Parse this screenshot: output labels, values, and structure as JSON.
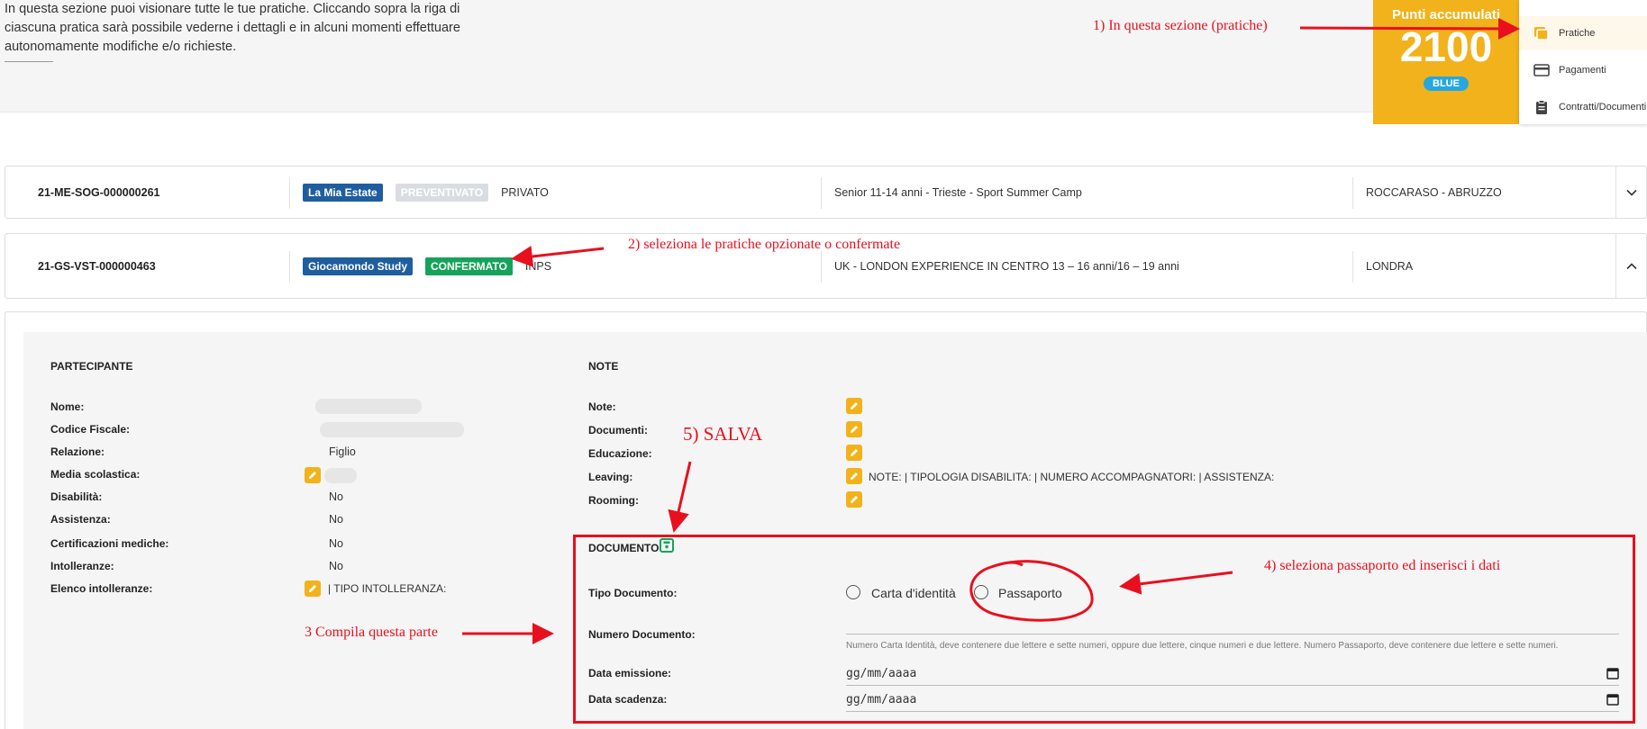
{
  "intro": {
    "line1": "In questa sezione puoi visionare tutte le tue pratiche. Cliccando sopra la riga di",
    "line2": "ciascuna pratica sarà possibile vederne i dettagli e in alcuni momenti effettuare",
    "line3": "autonomamente modifiche e/o richieste."
  },
  "points": {
    "title": "Punti accumulati",
    "value": "2100",
    "level": "BLUE"
  },
  "side_menu": {
    "items": [
      {
        "label": "Pratiche",
        "icon": "folder-icon",
        "active": true
      },
      {
        "label": "Pagamenti",
        "icon": "credit-card-icon",
        "active": false
      },
      {
        "label": "Contratti/Documenti",
        "icon": "clipboard-icon",
        "active": false
      }
    ]
  },
  "practices": [
    {
      "code": "21-ME-SOG-000000261",
      "brand": "La Mia Estate",
      "status": "PREVENTIVATO",
      "type": "PRIVATO",
      "description": "Senior 11-14 anni - Trieste - Sport Summer Camp",
      "location": "ROCCARASO - ABRUZZO"
    },
    {
      "code": "21-GS-VST-000000463",
      "brand": "Giocamondo Study",
      "status": "CONFERMATO",
      "type": "INPS",
      "description": "UK - LONDON EXPERIENCE IN CENTRO 13 – 16 anni/16 – 19 anni",
      "location": "LONDRA"
    }
  ],
  "participant": {
    "heading": "PARTECIPANTE",
    "fields": {
      "nome": "Nome:",
      "codice_fiscale": "Codice Fiscale:",
      "relazione": "Relazione:",
      "relazione_val": "Figlio",
      "media": "Media scolastica:",
      "disabilita": "Disabilità:",
      "disabilita_val": "No",
      "assistenza": "Assistenza:",
      "assistenza_val": "No",
      "certificazioni": "Certificazioni mediche:",
      "certificazioni_val": "No",
      "intolleranze": "Intolleranze:",
      "intolleranze_val": "No",
      "elenco": "Elenco intolleranze:",
      "elenco_val": "| TIPO INTOLLERANZA:"
    }
  },
  "notes": {
    "heading": "NOTE",
    "note": "Note:",
    "documenti": "Documenti:",
    "educazione": "Educazione:",
    "leaving": "Leaving:",
    "leaving_val": "NOTE:  | TIPOLOGIA DISABILITA:  | NUMERO ACCOMPAGNATORI:  | ASSISTENZA:",
    "rooming": "Rooming:"
  },
  "document": {
    "heading": "DOCUMENTO",
    "tipo": "Tipo Documento:",
    "opt_carta": "Carta d'identità",
    "opt_passaporto": "Passaporto",
    "numero": "Numero Documento:",
    "hint": "Numero Carta Identità, deve contenere due lettere e sette numeri, oppure due lettere, cinque numeri e due lettere. Numero Passaporto, deve contenere due lettere e sette numeri.",
    "emissione": "Data emissione:",
    "scadenza": "Data scadenza:",
    "date_placeholder": "gg/mm/aaaa"
  },
  "annotations": {
    "a1": "1) In questa sezione (pratiche)",
    "a2": "2) seleziona le pratiche opzionate o confermate",
    "a3": "3 Compila questa parte",
    "a4": "4) seleziona passaporto ed inserisci i dati",
    "a5": "5) SALVA"
  },
  "colors": {
    "brand_blue": "#1f5e9e",
    "confirmed_green": "#15a35a",
    "quoted_grey": "#d9dde2",
    "points_yellow": "#f2b21b",
    "badge_blue": "#27a7e0",
    "annotation_red": "#e8101e"
  }
}
